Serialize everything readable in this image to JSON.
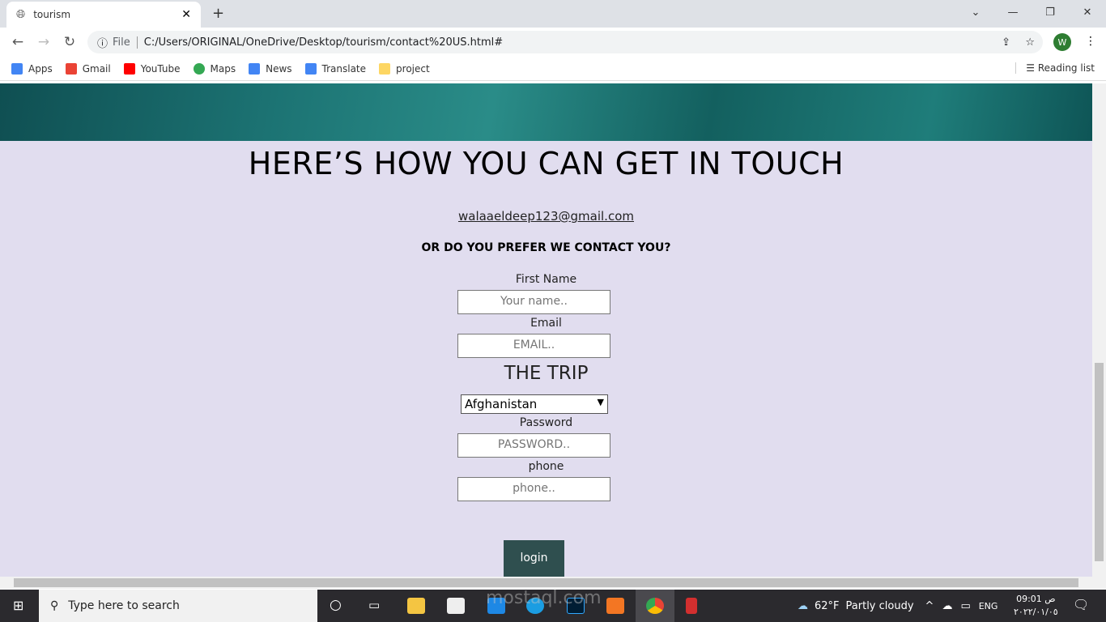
{
  "browser": {
    "tab_title": "tourism",
    "url_label": "File",
    "url": "C:/Users/ORIGINAL/OneDrive/Desktop/tourism/contact%20US.html#",
    "profile_initial": "W",
    "bookmarks": [
      {
        "label": "Apps",
        "color": "#4285f4"
      },
      {
        "label": "Gmail",
        "color": "#ea4335"
      },
      {
        "label": "YouTube",
        "color": "#ff0000"
      },
      {
        "label": "Maps",
        "color": "#34a853"
      },
      {
        "label": "News",
        "color": "#4285f4"
      },
      {
        "label": "Translate",
        "color": "#4285f4"
      },
      {
        "label": "project",
        "color": "#fdd663"
      }
    ],
    "reading_list": "Reading list"
  },
  "page": {
    "heading": "HERE’S HOW YOU CAN GET IN TOUCH",
    "email_link": "walaaeldeep123@gmail.com",
    "prefer": "OR DO YOU PREFER WE CONTACT YOU?",
    "first_name_label": "First Name",
    "first_name_placeholder": "Your name..",
    "email_label": "Email",
    "email_placeholder": "EMAIL..",
    "trip_label": "THE TRIP",
    "trip_selected": "Afghanistan",
    "password_label": "Password",
    "password_placeholder": "PASSWORD..",
    "phone_label": "phone",
    "phone_placeholder": "phone..",
    "login_button": "login",
    "accent": "#2f4f4f",
    "background": "#e1ddef"
  },
  "taskbar": {
    "search_placeholder": "Type here to search",
    "weather_temp": "62°F",
    "weather_text": "Partly cloudy",
    "language": "ENG",
    "time": "09:01 ص",
    "date": "٢٠٢٢/٠١/٠٥",
    "watermark": "mostaql.com"
  }
}
